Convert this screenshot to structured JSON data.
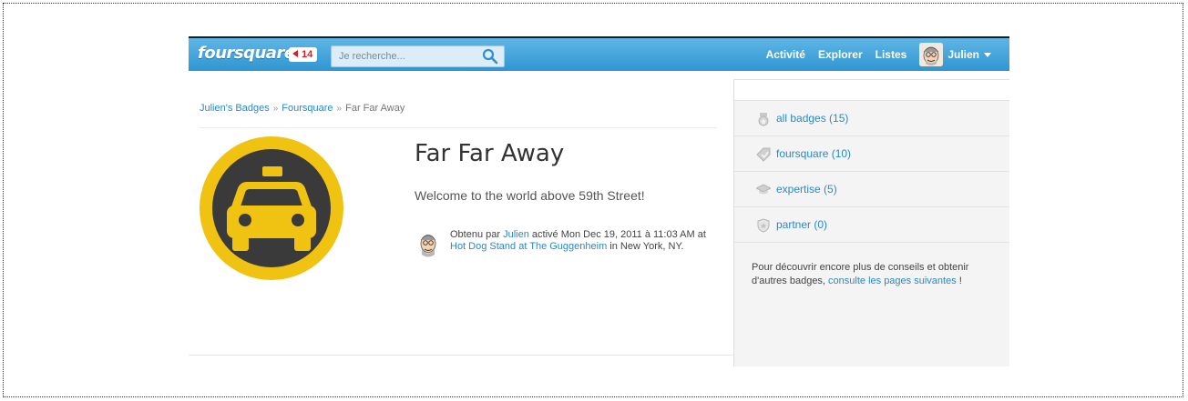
{
  "topbar": {
    "logo": "foursquare",
    "notification_count": "14",
    "search_placeholder": "Je recherche...",
    "nav": [
      "Activité",
      "Explorer",
      "Listes"
    ],
    "user_name": "Julien"
  },
  "breadcrumb": {
    "items": [
      "Julien's Badges",
      "Foursquare",
      "Far Far Away"
    ],
    "separator": "»"
  },
  "badge": {
    "title": "Far Far Away",
    "description": "Welcome to the world above 59th Street!",
    "unlock": {
      "prefix": "Obtenu par ",
      "user": "Julien",
      "middle": " activé Mon Dec 19, 2011 à 11:03 AM at ",
      "venue": "Hot Dog Stand at The Guggenheim",
      "suffix": " in New York, NY."
    },
    "colors": {
      "ring": "#f0c313",
      "inner": "#3a3a3a"
    }
  },
  "sidebar": {
    "items": [
      {
        "icon": "badge-icon",
        "label": "all badges (15)"
      },
      {
        "icon": "foursquare-tag-icon",
        "label": "foursquare (10)"
      },
      {
        "icon": "graduation-cap-icon",
        "label": "expertise (5)"
      },
      {
        "icon": "partner-shield-icon",
        "label": "partner (0)"
      }
    ],
    "tip": {
      "text1": "Pour découvrir encore plus de conseils et obtenir d'autres badges, ",
      "link": "consulte les pages suivantes",
      "text2": " !"
    }
  },
  "colors": {
    "brand_blue": "#2f95d0",
    "link": "#2a89c7"
  }
}
